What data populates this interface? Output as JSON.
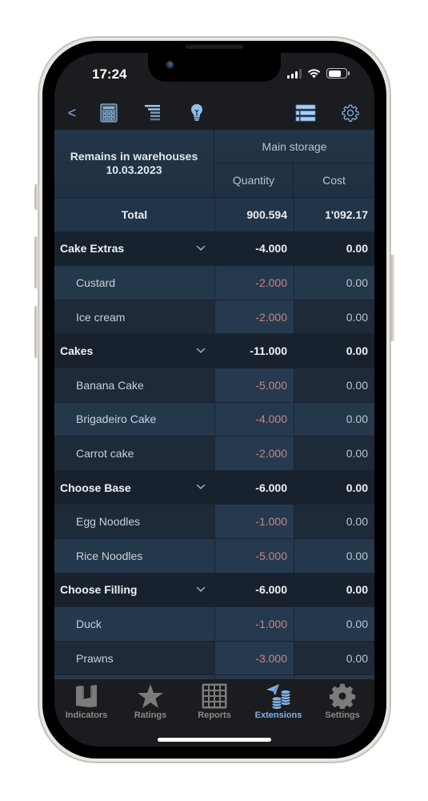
{
  "status_bar": {
    "time": "17:24",
    "signal_bars": 3,
    "battery_percent": 72
  },
  "toolbar": {
    "back_label": "<",
    "icons": [
      "calculator-icon",
      "hierarchy-list-icon",
      "lightbulb-icon",
      "list-view-icon",
      "gear-icon"
    ]
  },
  "table": {
    "title_line1": "Remains in warehouses",
    "title_line2": "10.03.2023",
    "storage": "Main storage",
    "col_quantity": "Quantity",
    "col_cost": "Cost",
    "total": {
      "label": "Total",
      "quantity": "900.594",
      "cost": "1'092.17"
    },
    "groups": [
      {
        "name": "Cake Extras",
        "quantity": "-4.000",
        "cost": "0.00",
        "items": [
          {
            "name": "Custard",
            "quantity": "-2.000",
            "cost": "0.00"
          },
          {
            "name": "Ice cream",
            "quantity": "-2.000",
            "cost": "0.00"
          }
        ]
      },
      {
        "name": "Cakes",
        "quantity": "-11.000",
        "cost": "0.00",
        "items": [
          {
            "name": "Banana Cake",
            "quantity": "-5.000",
            "cost": "0.00"
          },
          {
            "name": "Brigadeiro Cake",
            "quantity": "-4.000",
            "cost": "0.00"
          },
          {
            "name": "Carrot cake",
            "quantity": "-2.000",
            "cost": "0.00"
          }
        ]
      },
      {
        "name": "Choose Base",
        "quantity": "-6.000",
        "cost": "0.00",
        "items": [
          {
            "name": "Egg Noodles",
            "quantity": "-1.000",
            "cost": "0.00"
          },
          {
            "name": "Rice Noodles",
            "quantity": "-5.000",
            "cost": "0.00"
          }
        ]
      },
      {
        "name": "Choose Filling",
        "quantity": "-6.000",
        "cost": "0.00",
        "items": [
          {
            "name": "Duck",
            "quantity": "-1.000",
            "cost": "0.00"
          },
          {
            "name": "Prawns",
            "quantity": "-3.000",
            "cost": "0.00"
          }
        ]
      }
    ]
  },
  "tabbar": {
    "active": "Extensions",
    "tabs": [
      {
        "label": "Indicators",
        "icon": "indicators-icon"
      },
      {
        "label": "Ratings",
        "icon": "star-icon"
      },
      {
        "label": "Reports",
        "icon": "grid-icon"
      },
      {
        "label": "Extensions",
        "icon": "extensions-coins-icon"
      },
      {
        "label": "Settings",
        "icon": "gear-icon"
      }
    ]
  },
  "colors": {
    "accent": "#7fb3e8",
    "negative": "#c98585",
    "inactive_tab": "#8a8a8a"
  }
}
